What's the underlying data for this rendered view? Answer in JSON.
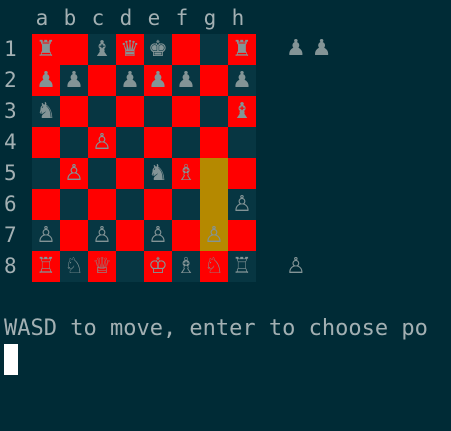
{
  "files": [
    "a",
    "b",
    "c",
    "d",
    "e",
    "f",
    "g",
    "h"
  ],
  "ranks": [
    "1",
    "2",
    "3",
    "4",
    "5",
    "6",
    "7",
    "8"
  ],
  "board": [
    [
      {
        "p": "♜",
        "c": "red"
      },
      {
        "p": "",
        "c": "red"
      },
      {
        "p": "♝",
        "c": "dark"
      },
      {
        "p": "♛",
        "c": "red"
      },
      {
        "p": "♚",
        "c": "dark"
      },
      {
        "p": "",
        "c": "red"
      },
      {
        "p": "",
        "c": "dark"
      },
      {
        "p": "♜",
        "c": "red"
      }
    ],
    [
      {
        "p": "♟",
        "c": "red"
      },
      {
        "p": "♟",
        "c": "dark"
      },
      {
        "p": "",
        "c": "red"
      },
      {
        "p": "♟",
        "c": "dark"
      },
      {
        "p": "♟",
        "c": "red"
      },
      {
        "p": "♟",
        "c": "dark"
      },
      {
        "p": "",
        "c": "red"
      },
      {
        "p": "♟",
        "c": "dark"
      }
    ],
    [
      {
        "p": "♞",
        "c": "dark"
      },
      {
        "p": "",
        "c": "red"
      },
      {
        "p": "",
        "c": "dark"
      },
      {
        "p": "",
        "c": "red"
      },
      {
        "p": "",
        "c": "dark"
      },
      {
        "p": "",
        "c": "red"
      },
      {
        "p": "",
        "c": "dark"
      },
      {
        "p": "♝",
        "c": "red"
      }
    ],
    [
      {
        "p": "",
        "c": "red"
      },
      {
        "p": "",
        "c": "dark"
      },
      {
        "p": "♙",
        "c": "red"
      },
      {
        "p": "",
        "c": "dark"
      },
      {
        "p": "",
        "c": "red"
      },
      {
        "p": "",
        "c": "dark"
      },
      {
        "p": "",
        "c": "red"
      },
      {
        "p": "",
        "c": "dark"
      }
    ],
    [
      {
        "p": "",
        "c": "dark"
      },
      {
        "p": "♙",
        "c": "red"
      },
      {
        "p": "",
        "c": "dark"
      },
      {
        "p": "",
        "c": "red"
      },
      {
        "p": "♞",
        "c": "dark"
      },
      {
        "p": "♗",
        "c": "red"
      },
      {
        "p": "",
        "c": "hl"
      },
      {
        "p": "",
        "c": "red"
      }
    ],
    [
      {
        "p": "",
        "c": "red"
      },
      {
        "p": "",
        "c": "dark"
      },
      {
        "p": "",
        "c": "red"
      },
      {
        "p": "",
        "c": "dark"
      },
      {
        "p": "",
        "c": "red"
      },
      {
        "p": "",
        "c": "dark"
      },
      {
        "p": "",
        "c": "hl"
      },
      {
        "p": "♙",
        "c": "dark"
      }
    ],
    [
      {
        "p": "♙",
        "c": "dark"
      },
      {
        "p": "",
        "c": "red"
      },
      {
        "p": "♙",
        "c": "dark"
      },
      {
        "p": "",
        "c": "red"
      },
      {
        "p": "♙",
        "c": "dark"
      },
      {
        "p": "",
        "c": "red"
      },
      {
        "p": "♙",
        "c": "hl"
      },
      {
        "p": "",
        "c": "red"
      }
    ],
    [
      {
        "p": "♖",
        "c": "red"
      },
      {
        "p": "♘",
        "c": "dark"
      },
      {
        "p": "♕",
        "c": "red"
      },
      {
        "p": "",
        "c": "dark"
      },
      {
        "p": "♔",
        "c": "red"
      },
      {
        "p": "♗",
        "c": "dark"
      },
      {
        "p": "♘",
        "c": "red"
      },
      {
        "p": "♖",
        "c": "dark"
      }
    ]
  ],
  "captured_top": "♟♟",
  "captured_bottom": "♙",
  "message": "WASD to move, enter to choose po",
  "colors": {
    "background": "#002b36",
    "light_square": "#ff0000",
    "dark_square": "#073642",
    "highlight": "#b58900",
    "piece": "#839496",
    "text": "#a3b0b3"
  }
}
